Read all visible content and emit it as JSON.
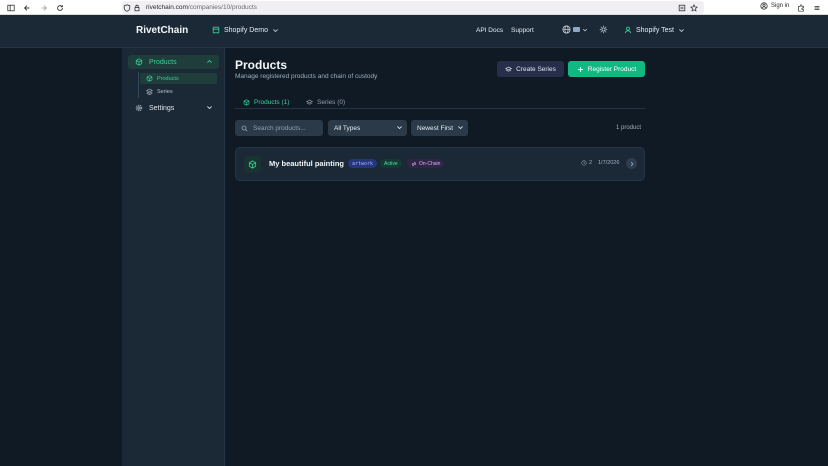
{
  "browser": {
    "url_host": "rivetchain.com",
    "url_path": "/companies/10/products",
    "signin_label": "Sign in"
  },
  "header": {
    "brand": "RivetChain",
    "org_name": "Shopify Demo",
    "nav": [
      "API Docs",
      "Support"
    ],
    "user_name": "Shopify Test"
  },
  "sidebar": {
    "items": [
      {
        "label": "Products",
        "active": true,
        "children": [
          {
            "label": "Products",
            "active": true
          },
          {
            "label": "Series",
            "active": false
          }
        ]
      },
      {
        "label": "Settings",
        "active": false
      }
    ]
  },
  "main": {
    "title": "Products",
    "subtitle": "Manage registered products and chain of custody",
    "create_series_label": "Create Series",
    "register_product_label": "Register Product",
    "tabs": [
      {
        "label": "Products (1)",
        "active": true
      },
      {
        "label": "Series (0)",
        "active": false
      }
    ],
    "search_placeholder": "Search products...",
    "type_filter": "All Types",
    "sort": "Newest First",
    "count_text": "1 product"
  },
  "products": [
    {
      "name": "My beautiful painting",
      "type": "artwork",
      "status": "Active",
      "chain": "On-Chain",
      "events": "2",
      "date": "1/7/2026"
    }
  ],
  "colors": {
    "accent": "#10b981",
    "accent_text": "#34d399",
    "background": "#0f1a24",
    "panel": "#1b2936"
  }
}
